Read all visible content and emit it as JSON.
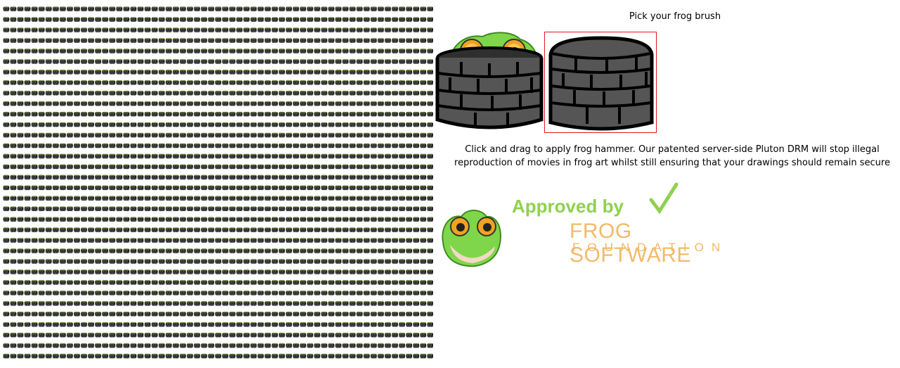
{
  "canvas": {
    "brick_tile_icon": "brick-wall-tile"
  },
  "picker": {
    "title": "Pick your frog brush",
    "brushes": [
      {
        "name": "frog-in-wall",
        "icon": "frog-peeking-over-brick-wall",
        "selected": false
      },
      {
        "name": "brick-wall",
        "icon": "brick-wall",
        "selected": true
      }
    ]
  },
  "instructions": {
    "line1": "Click and drag to apply frog hammer. Our patented server-side Pluton DRM will stop illegal",
    "line2": "reproduction of movies in frog art whilst still ensuring that your drawings should remain secure"
  },
  "badge": {
    "approved_text": "Approved by",
    "org_line1": "FROG SOFTWARE",
    "org_line2": "FOUNDATION",
    "check_icon": "green-check-icon",
    "frog_icon": "frog-face-icon",
    "colors": {
      "approved": "#8fd14f",
      "org": "#f3b96a",
      "selected_border": "#e0191e"
    }
  }
}
